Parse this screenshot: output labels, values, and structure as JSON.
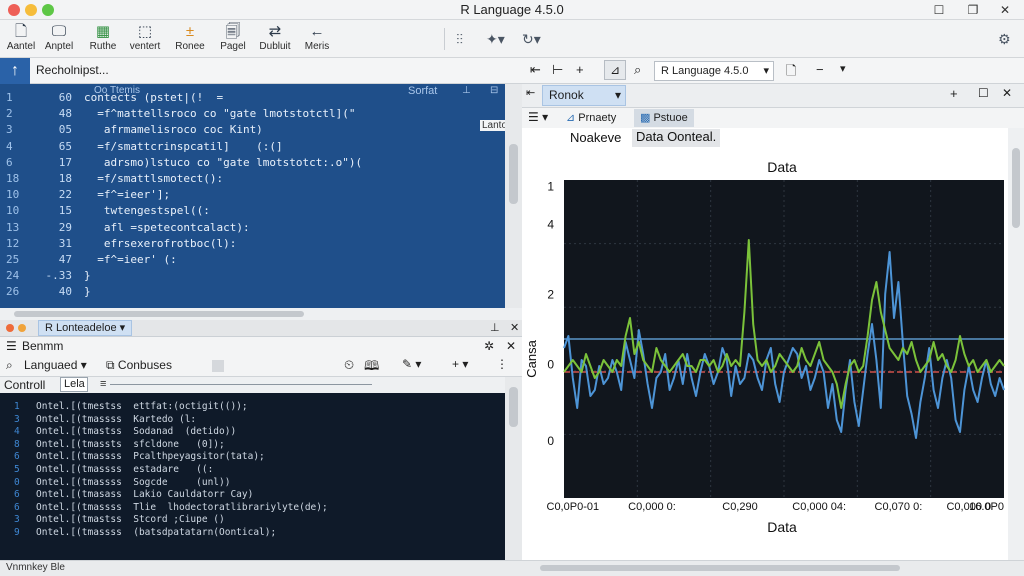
{
  "window": {
    "title": "R Language 4.5.0",
    "controls": [
      "☐",
      "❐",
      "✕"
    ]
  },
  "toolbar": {
    "items": [
      {
        "label": "Aantel",
        "icon": "new-file-icon",
        "glyph": "🗋"
      },
      {
        "label": "Anptel",
        "icon": "document-icon",
        "glyph": "🖵"
      },
      {
        "label": "Ruthe",
        "icon": "package-icon",
        "glyph": "▦"
      },
      {
        "label": "ventert",
        "icon": "export-icon",
        "glyph": "⬚"
      },
      {
        "label": "Ronee",
        "icon": "run-icon",
        "glyph": "±"
      },
      {
        "label": "Pagel",
        "icon": "page-icon",
        "glyph": "🗐"
      },
      {
        "label": "Dubluit",
        "icon": "split-icon",
        "glyph": "⇄"
      },
      {
        "label": "Meris",
        "icon": "back-arrow-icon",
        "glyph": "←"
      }
    ],
    "right_icons": [
      "grid-icon",
      "pointer-icon",
      "refresh-icon",
      "settings-icon"
    ]
  },
  "editor": {
    "file_label": "Recholnipst...",
    "header_left": "Oo Ttemis",
    "header_right": "Sorfat",
    "side_label": "Lanto",
    "lines": [
      {
        "a": "1",
        "b": "60",
        "code": "contects (pstet|(!  ="
      },
      {
        "a": "2",
        "b": "48",
        "code": "  =f^mattellsroco co \"gate lmotstotctl](\""
      },
      {
        "a": "3",
        "b": "05",
        "code": "   afrmamelisroco coc Kint)"
      },
      {
        "a": "4",
        "b": "65",
        "code": "  =f/smattcrinspcatil]    (:(]"
      },
      {
        "a": "6",
        "b": "17",
        "code": "   adrsmo)lstuco co \"gate lmotstotct:.o\")("
      },
      {
        "a": "18",
        "b": "18",
        "code": "  =f/smattlsmotect():"
      },
      {
        "a": "10",
        "b": "22",
        "code": "  =f^=ieer'];"
      },
      {
        "a": "10",
        "b": "15",
        "code": "   twtengestspel((:"
      },
      {
        "a": "13",
        "b": "29",
        "code": "   afl =spetecontcalact):"
      },
      {
        "a": "12",
        "b": "31",
        "code": "   efrsexerofrotboc(l):"
      },
      {
        "a": "25",
        "b": "47",
        "code": "  =f^=ieer' (:"
      },
      {
        "a": "24",
        "b": "-.33",
        "code": "}"
      },
      {
        "a": "26",
        "b": "40",
        "code": "}"
      }
    ]
  },
  "console": {
    "tab_label": "R Lonteadeloe",
    "title": "Benmm",
    "language_label": "Languaed",
    "combuses_label": "Conbuses",
    "control_label": "Controll",
    "left_tab": "Lela",
    "lines": [
      {
        "n": "1",
        "t": "Ontel.[(tmestss  ettfat:(octigit(());"
      },
      {
        "n": "3",
        "t": "Ontel.[(tmassss  Kartedo (l:"
      },
      {
        "n": "4",
        "t": "Ontel.[(tmastss  Sodanad  (detido))"
      },
      {
        "n": "8",
        "t": "Ontel.[(tmassts  sfcldone   (0]);"
      },
      {
        "n": "6",
        "t": "Ontel.[(tmassss  Pcalthpeyagsitor(tata);"
      },
      {
        "n": "5",
        "t": "Ontel.[(tmassss  estadare   ((:"
      },
      {
        "n": "0",
        "t": "Ontel.[(tmassss  Sogcde     (unl))"
      },
      {
        "n": "6",
        "t": "Ontel.[(tmasass  Lakio Cauldatorr Cay)"
      },
      {
        "n": "6",
        "t": "Ontel.[(tmassss  Tlie  lhodectoratlibrariylyte(de);"
      },
      {
        "n": "3",
        "t": "Ontel.[(tmastss  Stcord ;Ciupe ()"
      },
      {
        "n": "9",
        "t": "Ontel.[(tmassss  (batsdpatatarn(Oontical);"
      }
    ]
  },
  "right_pane": {
    "r_version": "R Language 4.5.0",
    "tab_label": "Ronok",
    "sub_tabs": [
      "Prnaety",
      "Pstuoe"
    ],
    "breadcrumb_1": "Noakeve",
    "breadcrumb_2": "Data Oonteal."
  },
  "status_bar": {
    "text": "Vnmnkey Ble"
  },
  "colors": {
    "editor_bg": "#1f4f8a",
    "console_bg": "#0f1a29",
    "plot_bg": "#11161d",
    "series_blue": "#4d94d6",
    "series_green": "#7bc23a",
    "ref_line_red": "#d0504b",
    "ref_line_blue": "#5a95c9"
  },
  "chart_data": {
    "type": "line",
    "title": "Data",
    "xlabel": "Data",
    "ylabel": "Cansa",
    "y_tick_labels": [
      "1",
      "4",
      "2",
      "0",
      "0"
    ],
    "x_tick_labels": [
      "C0,0P0-01",
      "C0,000 0:",
      "C0,290",
      "C0,000 04:",
      "C0,070 0:",
      "C0,000 0",
      "16.0P0"
    ],
    "ylim": [
      -2.1,
      3.2
    ],
    "xlim": [
      0,
      100
    ],
    "grid": true,
    "reference_lines": [
      {
        "name": "",
        "y": 0,
        "color": "#d0504b",
        "style": "dashed"
      },
      {
        "name": "",
        "y": 0.55,
        "color": "#5a95c9",
        "style": "solid"
      }
    ],
    "series": [
      {
        "color": "#4d94d6",
        "x": [
          0,
          1,
          2,
          3,
          4,
          5,
          6,
          7,
          8,
          9,
          10,
          11,
          12,
          13,
          14,
          15,
          16,
          17,
          18,
          19,
          20,
          21,
          22,
          23,
          24,
          25,
          26,
          27,
          28,
          29,
          30,
          31,
          32,
          33,
          34,
          35,
          36,
          37,
          38,
          39,
          40,
          41,
          42,
          43,
          44,
          45,
          46,
          47,
          48,
          49,
          50,
          51,
          52,
          53,
          54,
          55,
          56,
          57,
          58,
          59,
          60,
          61,
          62,
          63,
          64,
          65,
          66,
          67,
          68,
          69,
          70,
          71,
          72,
          73,
          74,
          75,
          76,
          77,
          78,
          79,
          80,
          81,
          82,
          83,
          84,
          85,
          86,
          87,
          88,
          89,
          90,
          91,
          92,
          93,
          94,
          95,
          96,
          97,
          98,
          99,
          100
        ],
        "values": [
          0.4,
          0.6,
          -0.1,
          -0.6,
          0.2,
          0.1,
          -0.4,
          -0.3,
          0.1,
          -0.2,
          -0.1,
          0.2,
          0.0,
          -0.3,
          0.5,
          0.2,
          -0.1,
          0.7,
          0.3,
          -0.2,
          -0.6,
          -0.1,
          0.0,
          0.3,
          -0.3,
          -0.1,
          0.2,
          -0.2,
          0.3,
          -0.1,
          -0.4,
          0.0,
          0.3,
          0.1,
          -0.2,
          0.0,
          0.4,
          0.2,
          -0.4,
          0.1,
          -0.2,
          -0.1,
          0.3,
          0.2,
          -0.1,
          -0.3,
          0.2,
          0.4,
          -0.2,
          -0.5,
          0.0,
          0.2,
          0.4,
          0.3,
          -0.1,
          0.1,
          -0.3,
          -0.1,
          0.2,
          0.0,
          -0.6,
          -0.2,
          -0.8,
          -1.0,
          -0.3,
          0.2,
          -0.5,
          -0.9,
          -0.3,
          0.3,
          0.8,
          0.2,
          -0.6,
          1.3,
          2.0,
          0.9,
          1.5,
          0.5,
          -0.4,
          -0.7,
          -1.1,
          -0.5,
          -0.1,
          0.4,
          -0.3,
          -0.6,
          -0.1,
          0.2,
          -0.1,
          -0.8,
          -1.0,
          -0.3,
          0.1,
          -0.3,
          -0.5,
          -0.1,
          0.2,
          -0.2,
          -0.4,
          -0.1,
          -0.3
        ]
      },
      {
        "color": "#7bc23a",
        "x": [
          0,
          1,
          2,
          3,
          4,
          5,
          6,
          7,
          8,
          9,
          10,
          11,
          12,
          13,
          14,
          15,
          16,
          17,
          18,
          19,
          20,
          21,
          22,
          23,
          24,
          25,
          26,
          27,
          28,
          29,
          30,
          31,
          32,
          33,
          34,
          35,
          36,
          37,
          38,
          39,
          40,
          41,
          42,
          43,
          44,
          45,
          46,
          47,
          48,
          49,
          50,
          51,
          52,
          53,
          54,
          55,
          56,
          57,
          58,
          59,
          60,
          61,
          62,
          63,
          64,
          65,
          66,
          67,
          68,
          69,
          70,
          71,
          72,
          73,
          74,
          75,
          76,
          77,
          78,
          79,
          80,
          81,
          82,
          83,
          84,
          85,
          86,
          87,
          88,
          89,
          90,
          91,
          92,
          93,
          94,
          95,
          96,
          97,
          98,
          99,
          100
        ],
        "values": [
          0.0,
          0.1,
          0.2,
          0.1,
          0.0,
          0.3,
          0.1,
          -0.1,
          0.0,
          0.2,
          0.1,
          0.0,
          0.2,
          0.1,
          0.6,
          0.9,
          0.3,
          0.5,
          0.2,
          0.1,
          0.0,
          0.4,
          0.2,
          0.1,
          0.0,
          0.1,
          0.2,
          0.3,
          0.1,
          0.1,
          0.0,
          0.2,
          0.2,
          0.1,
          0.2,
          0.0,
          0.1,
          0.3,
          0.1,
          0.2,
          0.1,
          1.0,
          2.2,
          0.8,
          0.2,
          0.1,
          0.2,
          0.0,
          0.1,
          0.3,
          0.2,
          0.1,
          0.0,
          0.1,
          0.4,
          0.2,
          0.1,
          0.3,
          0.5,
          0.2,
          0.1,
          0.0,
          -0.2,
          -0.6,
          -0.2,
          0.1,
          0.2,
          0.0,
          0.1,
          0.6,
          1.2,
          1.5,
          1.0,
          0.7,
          0.4,
          0.3,
          0.2,
          0.4,
          0.3,
          0.5,
          0.2,
          0.0,
          0.1,
          0.2,
          0.5,
          0.2,
          0.3,
          0.1,
          0.0,
          0.2,
          0.6,
          0.3,
          0.1,
          0.2,
          0.0,
          0.1,
          0.2,
          0.0,
          0.1,
          0.2,
          0.1
        ]
      }
    ]
  }
}
